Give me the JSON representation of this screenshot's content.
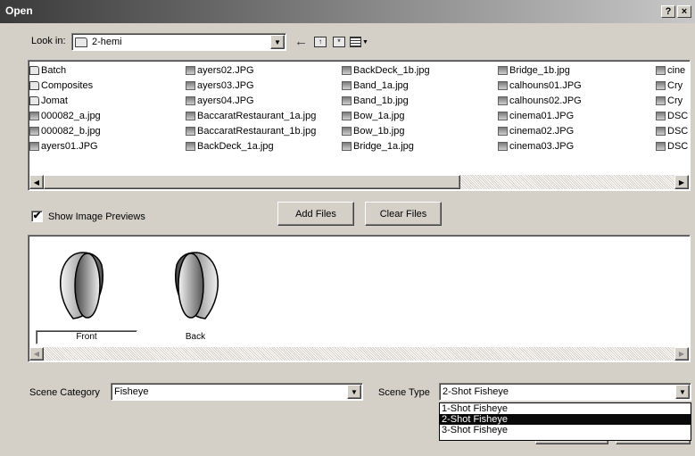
{
  "window": {
    "title": "Open",
    "help_label": "?",
    "close_label": "×"
  },
  "lookin": {
    "label": "Look in:",
    "value": "2-hemi"
  },
  "files": {
    "col1": [
      "Batch",
      "Composites",
      "Jomat",
      "000082_a.jpg",
      "000082_b.jpg",
      "ayers01.JPG"
    ],
    "col2": [
      "ayers02.JPG",
      "ayers03.JPG",
      "ayers04.JPG",
      "BaccaratRestaurant_1a.jpg",
      "BaccaratRestaurant_1b.jpg",
      "BackDeck_1a.jpg"
    ],
    "col3": [
      "BackDeck_1b.jpg",
      "Band_1a.jpg",
      "Band_1b.jpg",
      "Bow_1a.jpg",
      "Bow_1b.jpg",
      "Bridge_1a.jpg"
    ],
    "col4": [
      "Bridge_1b.jpg",
      "calhouns01.JPG",
      "calhouns02.JPG",
      "cinema01.JPG",
      "cinema02.JPG",
      "cinema03.JPG"
    ],
    "col5": [
      "cine",
      "Cry",
      "Cry",
      "DSC",
      "DSC",
      "DSC"
    ]
  },
  "preview": {
    "checkbox_label": "Show Image Previews",
    "checked": true,
    "add_label": "Add Files",
    "clear_label": "Clear Files",
    "thumbs": [
      "Front",
      "Back"
    ]
  },
  "scene": {
    "category_label": "Scene Category",
    "category_value": "Fisheye",
    "type_label": "Scene Type",
    "type_value": "2-Shot Fisheye",
    "type_options": [
      "1-Shot Fisheye",
      "2-Shot Fisheye",
      "3-Shot Fisheye"
    ],
    "selected_index": 1
  }
}
